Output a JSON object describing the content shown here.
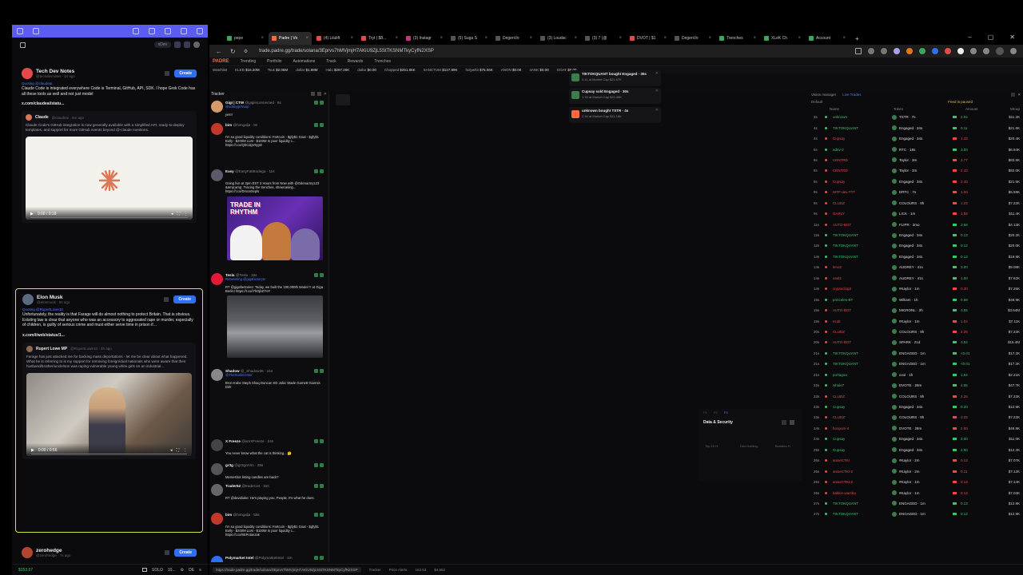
{
  "left_panel": {
    "toolbar_pill": "xDev",
    "posts": [
      {
        "name": "Tech Dev Notes",
        "handle": "@techdevnotes · 1s ago",
        "mention": "Quoting @claudeai",
        "text": "Claude Code is integrated everywhere Code is Terminal, GitHub, API, SDK. I hope Grok Code has all these tools as well and not just model",
        "link": "x.com/claudeai/statu...",
        "quote_name": "Claude",
        "quote_handle": "@claudeai · 6m ago",
        "quote_text": "Claude Code's GitHub integration is now generally available with a simplified API, ready-to-deploy templates, and support for more GitHub events beyond @-claude mentions.",
        "video_time": "0:00 / 0:18",
        "create_label": "Create"
      },
      {
        "name": "Elon Musk",
        "handle": "@elonmusk · 5s ago",
        "mention": "Quoting @RupertLowe10",
        "text": "Unfortunately, the reality is that Farage will do almost nothing to protect Britain. That is obvious. Existing law is clear that anyone who was an accessory to aggravated rape or murder, especially of children, is guilty of serious crime and must either serve time in prison if...",
        "link": "x.com/i/web/status/1...",
        "quote_name": "Rupert Lowe MP",
        "quote_handle": "@RupertLowe10 · 4h ago",
        "quote_text": "Farage has just attacked me for backing mass deportations - let me be clear about what happened. What he is referring to is my support for removing foreign/dual nationals who were aware that their husband/brother/uncle/son was raping vulnerable young white girls on an industrial...",
        "video_time": "0:00 / 0:56",
        "create_label": "Create"
      },
      {
        "name": "zerohedge",
        "handle": "@zerohedge · 7s ago",
        "create_label": "Create"
      }
    ],
    "status": {
      "balance": "$153.67",
      "mode": "SOLO",
      "amount": "10...",
      "lang": "DE"
    }
  },
  "browser": {
    "tabs": [
      {
        "label": "pepe",
        "color": "#3aa55d"
      },
      {
        "label": "Padre | Vo",
        "color": "#ff6a3d"
      },
      {
        "label": "(4) Lilulift",
        "color": "#e34b4b"
      },
      {
        "label": "Tryt | $8...",
        "color": "#e34b4b"
      },
      {
        "label": "(3) Instagr",
        "color": "#c13584"
      },
      {
        "label": "(5) Suga S",
        "color": "#555555"
      },
      {
        "label": "DegenVo",
        "color": "#555555"
      },
      {
        "label": "(3) Loudsc",
        "color": "#555555"
      },
      {
        "label": "(3) 7 (@",
        "color": "#555555"
      },
      {
        "label": "DVOT | $1",
        "color": "#e34b4b"
      },
      {
        "label": "DegenVo",
        "color": "#555555"
      },
      {
        "label": "Trenches",
        "color": "#3aa55d"
      },
      {
        "label": "XLeK Ch",
        "color": "#3aa55d"
      },
      {
        "label": "Account",
        "color": "#3aa55d"
      }
    ],
    "url": "trade.padre.gg/trade/solana/3Eprvs7hMVjmjH7AKiU9ZjL5StTKSNMTkyCyfN2XSP",
    "padre_nav": [
      "PADRE",
      "Trending",
      "Portfolio",
      "Automations",
      "Track",
      "Rewards",
      "Trenches"
    ],
    "ticker": [
      {
        "k": "Watchlist",
        "v": ""
      },
      {
        "k": "KLED",
        "v": "$16.20M"
      },
      {
        "k": "Tsuk",
        "v": "$2.05M"
      },
      {
        "k": "dollar",
        "v": "$1.98M"
      },
      {
        "k": "Halo",
        "v": "$297.26K"
      },
      {
        "k": "dollar",
        "v": "$0.00"
      },
      {
        "k": "Chopped",
        "v": "$251.86K"
      },
      {
        "k": "SANCTUM",
        "v": "$127.99K"
      },
      {
        "k": "holywhit",
        "v": "$75.06K"
      },
      {
        "k": "ANON",
        "v": "$0.00"
      },
      {
        "k": "4ANK",
        "v": "$0.00"
      },
      {
        "k": "GOAT",
        "v": "$0.00"
      }
    ],
    "tracker_title": "Tracker",
    "tweets": [
      {
        "name": "GigI | CTW",
        "handle": "@gigiisconnected · 8s",
        "mention": "@volleygirlvoop",
        "body": "yes!!",
        "color": "#d49a6a"
      },
      {
        "name": "bim",
        "handle": "@himgalja · 9s",
        "mention": "",
        "body": "I'm so good liquidity conditions: Fartcoin - $gfy$1 Goat - $gfy$1 Bully - $200M LLM - $100M In poor liquidity c... https://t.co/QbCdgV6yyD",
        "color": "#c0392b"
      },
      {
        "name": "Easy",
        "handle": "@EasyFatiBodega · 11s",
        "mention": "",
        "body": "Going live at 3pm EST 3 Hours from Now with @Odenarmy123 &amp;amp; Tracing the trenches, showcasing... https://t.co/DmceDepls",
        "color": "#5a5a6a",
        "graphic": "TRADE IN RHYTHM"
      },
      {
        "name": "Tesla",
        "handle": "@Tesla · 15s",
        "mention": "Retweeting @gigafactorytx",
        "body": "RT @gigafactories: Today, we built the 100,000th Model Y at Giga Berlin! https://t.co/i7hOjbZ7HY",
        "color": "#e31937"
      },
      {
        "name": "Shadow",
        "handle": "@_Shadow36 · 21s",
        "mention": "@TheDunkCenter",
        "body": "Bron Kobe Steph Shaq Duncan KD Jokic Wade Garnett Giannis Dirk",
        "color": "#888888"
      },
      {
        "name": "X Freeze",
        "handle": "@amXFreeze · 24s",
        "mention": "",
        "body": "You never know what the cat is thinking... 🤔",
        "color": "#444444"
      },
      {
        "name": "gr3g",
        "handle": "@gr3gorVin · 28s",
        "mention": "",
        "body": "Memeshot listing candles are back?",
        "color": "#555555"
      },
      {
        "name": "Trader52",
        "handle": "@trader1st · 32s",
        "mention": "",
        "body": "RT @davidiuke: He's playing you, People. It's what he does.",
        "color": "#666666"
      },
      {
        "name": "bim",
        "handle": "@himgalja · 55s",
        "mention": "",
        "body": "I'm so good liquidity conditions: Fartcoin - $gfy$1 Goat - $gfy$1 Bully - $200M LLM - $100M In poor liquidity c... https://t.co/8SPolanzak",
        "color": "#c0392b"
      },
      {
        "name": "Polymarket Intel",
        "handle": "@PolymarketIntel · 1m",
        "mention": "",
        "body": "",
        "color": "#2f6ff2"
      }
    ],
    "notifications": [
      {
        "title": "TIKTOKQUANT bought Engaged · 30s",
        "sub": "0.11 at Market Cap $21.67K",
        "color": "#3c7d4e"
      },
      {
        "title": "Cupsay sold Engaged · 30s",
        "sub": "1.33 at Market Cap $20.48K",
        "color": "#3c7d4e"
      },
      {
        "title": "unknown bought TSTR · 4s",
        "sub": "2.94 at Market Cap $11.18K",
        "color": "#ff6a3d"
      }
    ],
    "data_security": {
      "title": "Data & Security",
      "labels": [
        "Top 10 H.",
        "Dev Holding",
        "Bundles H."
      ]
    },
    "vision_manager": {
      "title": "Vision manager",
      "live_label": "Live Trades",
      "default_label": "Default",
      "paused_label": "Feed is paused",
      "cols": [
        "Name",
        "Token",
        "Amount",
        "MCap"
      ],
      "rows": [
        {
          "age": "3s",
          "name": "unknown",
          "token": "TSTR · 7s",
          "amount": "2.94",
          "mc": "$11.2K",
          "nc": "#3fc06a",
          "ac": "#3fc06a"
        },
        {
          "age": "4s",
          "name": "TIKTOKQUANT",
          "token": "Engaged · 34s",
          "amount": "0.11",
          "mc": "$21.6K",
          "nc": "#3fc06a",
          "ac": "#3fc06a"
        },
        {
          "age": "4s",
          "name": "Cupsay",
          "token": "Engaged · 34s",
          "amount": "1.33",
          "mc": "$20.4K",
          "nc": "#e34b4b",
          "ac": "#e34b4b"
        },
        {
          "age": "6s",
          "name": "adev-2",
          "token": "RTC · 18s",
          "amount": "3.00",
          "mc": "$6.84K",
          "nc": "#3fc06a",
          "ac": "#3fc06a"
        },
        {
          "age": "8s",
          "name": "CENTRD",
          "token": "Taylor · 3m",
          "amount": "2.77",
          "mc": "$83.5K",
          "nc": "#e34b4b",
          "ac": "#e34b4b"
        },
        {
          "age": "8s",
          "name": "CENTRD",
          "token": "Taylor · 3m",
          "amount": "2.10",
          "mc": "$82.0K",
          "nc": "#e34b4b",
          "ac": "#e34b4b"
        },
        {
          "age": "8s",
          "name": "Cupsay",
          "token": "Engaged · 34s",
          "amount": "2.40",
          "mc": "$21.5K",
          "nc": "#e34b4b",
          "ac": "#e34b4b"
        },
        {
          "age": "9s",
          "name": "WTF-dev-TTT",
          "token": "DRTC · 7s",
          "amount": "1.00",
          "mc": "$5.59K",
          "nc": "#e34b4b",
          "ac": "#e34b4b"
        },
        {
          "age": "9s",
          "name": "CLUDZ",
          "token": "COLOURS · 9h",
          "amount": "1.23",
          "mc": "$7.22K",
          "nc": "#e34b4b",
          "ac": "#e34b4b"
        },
        {
          "age": "9s",
          "name": "GARLY",
          "token": "LICK · 1m",
          "amount": "1.59",
          "mc": "$11.4K",
          "nc": "#e34b4b",
          "ac": "#e34b4b"
        },
        {
          "age": "11s",
          "name": "AUTO-BOT",
          "token": "FLIPR · 2mo",
          "amount": "3.58",
          "mc": "$4.13K",
          "nc": "#e34b4b",
          "ac": "#3fc06a"
        },
        {
          "age": "12s",
          "name": "TIKTOKQUANT",
          "token": "Engaged · 34s",
          "amount": "0.13",
          "mc": "$20.2K",
          "nc": "#3fc06a",
          "ac": "#3fc06a"
        },
        {
          "age": "12s",
          "name": "TIKTOKQUANT",
          "token": "Engaged · 34s",
          "amount": "0.12",
          "mc": "$20.0K",
          "nc": "#3fc06a",
          "ac": "#3fc06a"
        },
        {
          "age": "14s",
          "name": "TIKTOKQUANT",
          "token": "Engaged · 34s",
          "amount": "0.13",
          "mc": "$19.8K",
          "nc": "#3fc06a",
          "ac": "#3fc06a"
        },
        {
          "age": "14s",
          "name": "leno2",
          "token": "AUDREY · 41s",
          "amount": "3.00",
          "mc": "$9.08K",
          "nc": "#e34b4b",
          "ac": "#3fc06a"
        },
        {
          "age": "14s",
          "name": "vanl2",
          "token": "AUDREY · 41s",
          "amount": "1.50",
          "mc": "$7.62K",
          "nc": "#e34b4b",
          "ac": "#3fc06a"
        },
        {
          "age": "14s",
          "name": "cryptoclog3",
          "token": "#Kaylor · 1m",
          "amount": "0.30",
          "mc": "$7.25K",
          "nc": "#e34b4b",
          "ac": "#e34b4b"
        },
        {
          "age": "15s",
          "name": "princeles-BT",
          "token": "William · 1h",
          "amount": "0.68",
          "mc": "$48.9K",
          "nc": "#3fc06a",
          "ac": "#3fc06a"
        },
        {
          "age": "15s",
          "name": "AUTO-BOT",
          "token": "MICRONL · 2h",
          "amount": "3.55",
          "mc": "$3.64M",
          "nc": "#e34b4b",
          "ac": "#3fc06a"
        },
        {
          "age": "16s",
          "name": "ecolt",
          "token": "#Kaylor · 1m",
          "amount": "1.04",
          "mc": "$7.11K",
          "nc": "#e34b4b",
          "ac": "#e34b4b"
        },
        {
          "age": "20s",
          "name": "CLUDZ",
          "token": "COLOURS · 9h",
          "amount": "2.25",
          "mc": "$7.22K",
          "nc": "#e34b4b",
          "ac": "#e34b4b"
        },
        {
          "age": "20s",
          "name": "AUTO-BOT",
          "token": "SPARK · 21d",
          "amount": "3.54",
          "mc": "$15.4M",
          "nc": "#e34b4b",
          "ac": "#3fc06a"
        },
        {
          "age": "21s",
          "name": "TIKTOKQUANT",
          "token": "ENGAGED · 1m",
          "amount": "<0.01",
          "mc": "$17.2K",
          "nc": "#3fc06a",
          "ac": "#3fc06a"
        },
        {
          "age": "21s",
          "name": "TIKTOKQUANT",
          "token": "ENGAGED · 1m",
          "amount": "<0.01",
          "mc": "$17.2K",
          "nc": "#3fc06a",
          "ac": "#3fc06a"
        },
        {
          "age": "21s",
          "name": "portagoa",
          "token": "cool · 1h",
          "amount": "1.84",
          "mc": "$2.21K",
          "nc": "#3fc06a",
          "ac": "#3fc06a"
        },
        {
          "age": "22s",
          "name": "whale7",
          "token": "DVOTE · 28m",
          "amount": "4.86",
          "mc": "$47.7K",
          "nc": "#3fc06a",
          "ac": "#3fc06a"
        },
        {
          "age": "23s",
          "name": "CLUDZ",
          "token": "COLOURS · 9h",
          "amount": "2.25",
          "mc": "$7.22K",
          "nc": "#e34b4b",
          "ac": "#e34b4b"
        },
        {
          "age": "23s",
          "name": "Cupsay",
          "token": "Engaged · 34s",
          "amount": "0.20",
          "mc": "$12.9K",
          "nc": "#3fc06a",
          "ac": "#3fc06a"
        },
        {
          "age": "23s",
          "name": "CLUDZ",
          "token": "COLOURS · 9h",
          "amount": "0.25",
          "mc": "$7.22K",
          "nc": "#e34b4b",
          "ac": "#e34b4b"
        },
        {
          "age": "24s",
          "name": "bonpom-4",
          "token": "DVOTE · 28m",
          "amount": "2.00",
          "mc": "$46.9K",
          "nc": "#e34b4b",
          "ac": "#e34b4b"
        },
        {
          "age": "24s",
          "name": "Cupsay",
          "token": "Engaged · 34s",
          "amount": "2.00",
          "mc": "$11.0K",
          "nc": "#3fc06a",
          "ac": "#3fc06a"
        },
        {
          "age": "25s",
          "name": "Cupsay",
          "token": "Engaged · 34s",
          "amount": "2.80",
          "mc": "$12.2K",
          "nc": "#3fc06a",
          "ac": "#3fc06a"
        },
        {
          "age": "26s",
          "name": "aniseCTKI",
          "token": "#Kaylor · 2m",
          "amount": "0.13",
          "mc": "$7.07K",
          "nc": "#e34b4b",
          "ac": "#e34b4b"
        },
        {
          "age": "26s",
          "name": "aniseCTKI-2",
          "token": "#Kaylor · 2m",
          "amount": "0.11",
          "mc": "$7.12K",
          "nc": "#e34b4b",
          "ac": "#e34b4b"
        },
        {
          "age": "26s",
          "name": "aniseCTKI-2",
          "token": "#Kaylor · 1m",
          "amount": "0.13",
          "mc": "$7.14K",
          "nc": "#e34b4b",
          "ac": "#e34b4b"
        },
        {
          "age": "26s",
          "name": "bakkie-wambo",
          "token": "#Kaylor · 1m",
          "amount": "0.13",
          "mc": "$7.03K",
          "nc": "#e34b4b",
          "ac": "#e34b4b"
        },
        {
          "age": "27s",
          "name": "TIKTOKQUANT",
          "token": "ENGAGED · 1m",
          "amount": "0.13",
          "mc": "$12.9K",
          "nc": "#3fc06a",
          "ac": "#3fc06a"
        },
        {
          "age": "27s",
          "name": "TIKTOKQUANT",
          "token": "ENGAGED · 1m",
          "amount": "0.13",
          "mc": "$12.9K",
          "nc": "#3fc06a",
          "ac": "#3fc06a"
        }
      ]
    },
    "status": {
      "url": "https://trade.padre.gg/trade/solana/3Eprvs7hMVjmjH7AKiU9ZjL5StTKSNMTkyCyfN2XSP",
      "tracker": "Tracker",
      "price": "Price Alerts",
      "sol": "163.53",
      "eth": "$4,552"
    }
  }
}
